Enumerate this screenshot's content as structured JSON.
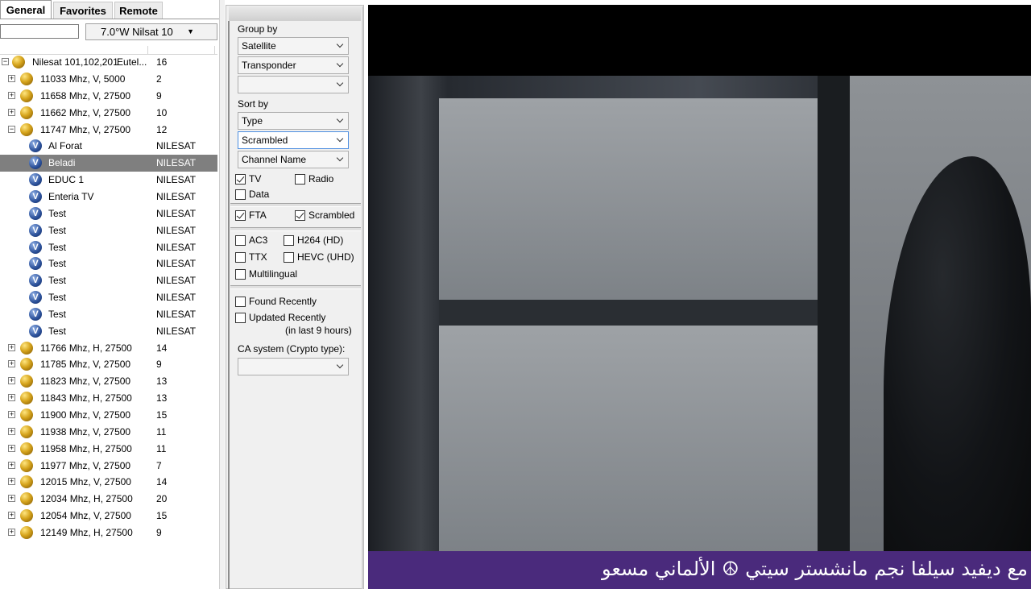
{
  "tabs": [
    {
      "label": "General",
      "active": true
    },
    {
      "label": "Favorites",
      "active": false
    },
    {
      "label": "Remote",
      "active": false
    }
  ],
  "satellite_select": {
    "value": "7.0°W Nilsat 10"
  },
  "tree": {
    "root": {
      "name": "Nilesat 101,102,201",
      "provider": "Eutel...",
      "count": "16"
    },
    "rows": [
      {
        "type": "tp",
        "exp": "+",
        "name": "11033 Mhz, V, 5000",
        "count": "2"
      },
      {
        "type": "tp",
        "exp": "+",
        "name": "11658 Mhz, V, 27500",
        "count": "9"
      },
      {
        "type": "tp",
        "exp": "+",
        "name": "11662 Mhz, V, 27500",
        "count": "10"
      },
      {
        "type": "tp",
        "exp": "−",
        "name": "11747 Mhz, V, 27500",
        "count": "12"
      },
      {
        "type": "ch",
        "name": "Al Forat",
        "count": "NILESAT"
      },
      {
        "type": "ch",
        "name": "Beladi",
        "count": "NILESAT",
        "selected": true
      },
      {
        "type": "ch",
        "name": "EDUC 1",
        "count": "NILESAT"
      },
      {
        "type": "ch",
        "name": "Enteria TV",
        "count": "NILESAT"
      },
      {
        "type": "ch",
        "name": "Test",
        "count": "NILESAT"
      },
      {
        "type": "ch",
        "name": "Test",
        "count": "NILESAT"
      },
      {
        "type": "ch",
        "name": "Test",
        "count": "NILESAT"
      },
      {
        "type": "ch",
        "name": "Test",
        "count": "NILESAT"
      },
      {
        "type": "ch",
        "name": "Test",
        "count": "NILESAT"
      },
      {
        "type": "ch",
        "name": "Test",
        "count": "NILESAT"
      },
      {
        "type": "ch",
        "name": "Test",
        "count": "NILESAT"
      },
      {
        "type": "ch",
        "name": "Test",
        "count": "NILESAT"
      },
      {
        "type": "tp",
        "exp": "+",
        "name": "11766 Mhz, H, 27500",
        "count": "14"
      },
      {
        "type": "tp",
        "exp": "+",
        "name": "11785 Mhz, V, 27500",
        "count": "9"
      },
      {
        "type": "tp",
        "exp": "+",
        "name": "11823 Mhz, V, 27500",
        "count": "13"
      },
      {
        "type": "tp",
        "exp": "+",
        "name": "11843 Mhz, H, 27500",
        "count": "13"
      },
      {
        "type": "tp",
        "exp": "+",
        "name": "11900 Mhz, V, 27500",
        "count": "15"
      },
      {
        "type": "tp",
        "exp": "+",
        "name": "11938 Mhz, V, 27500",
        "count": "11"
      },
      {
        "type": "tp",
        "exp": "+",
        "name": "11958 Mhz, H, 27500",
        "count": "11"
      },
      {
        "type": "tp",
        "exp": "+",
        "name": "11977 Mhz, V, 27500",
        "count": "7"
      },
      {
        "type": "tp",
        "exp": "+",
        "name": "12015 Mhz, V, 27500",
        "count": "14"
      },
      {
        "type": "tp",
        "exp": "+",
        "name": "12034 Mhz, H, 27500",
        "count": "20"
      },
      {
        "type": "tp",
        "exp": "+",
        "name": "12054 Mhz, V, 27500",
        "count": "15"
      },
      {
        "type": "tp",
        "exp": "+",
        "name": "12149 Mhz, H, 27500",
        "count": "9"
      }
    ]
  },
  "filter": {
    "group_by_label": "Group by",
    "group_by": [
      "Satellite",
      "Transponder",
      ""
    ],
    "sort_by_label": "Sort by",
    "sort_by": [
      "Type",
      "Scrambled",
      "Channel Name"
    ],
    "tv": {
      "label": "TV",
      "checked": true
    },
    "radio": {
      "label": "Radio",
      "checked": false
    },
    "data": {
      "label": "Data",
      "checked": false
    },
    "fta": {
      "label": "FTA",
      "checked": true
    },
    "scrambled": {
      "label": "Scrambled",
      "checked": true
    },
    "ac3": {
      "label": "AC3",
      "checked": false
    },
    "h264": {
      "label": "H264 (HD)",
      "checked": false
    },
    "ttx": {
      "label": "TTX",
      "checked": false
    },
    "hevc": {
      "label": "HEVC (UHD)",
      "checked": false
    },
    "multilingual": {
      "label": "Multilingual",
      "checked": false
    },
    "found_recently": {
      "label": "Found Recently",
      "checked": false
    },
    "updated_recently": {
      "label": "Updated Recently",
      "checked": false
    },
    "updated_note": "(in last 9 hours)",
    "ca_label": "CA system (Crypto type):",
    "ca_value": ""
  },
  "video": {
    "ticker_text": "مع ديفيد سيلفا نجم مانشستر سيتي  ☮  الألماني مسعو"
  },
  "colors": {
    "selection": "#7f7f7f",
    "ticker_bg": "#4a2a7c",
    "focus_border": "#4d8ee0"
  }
}
